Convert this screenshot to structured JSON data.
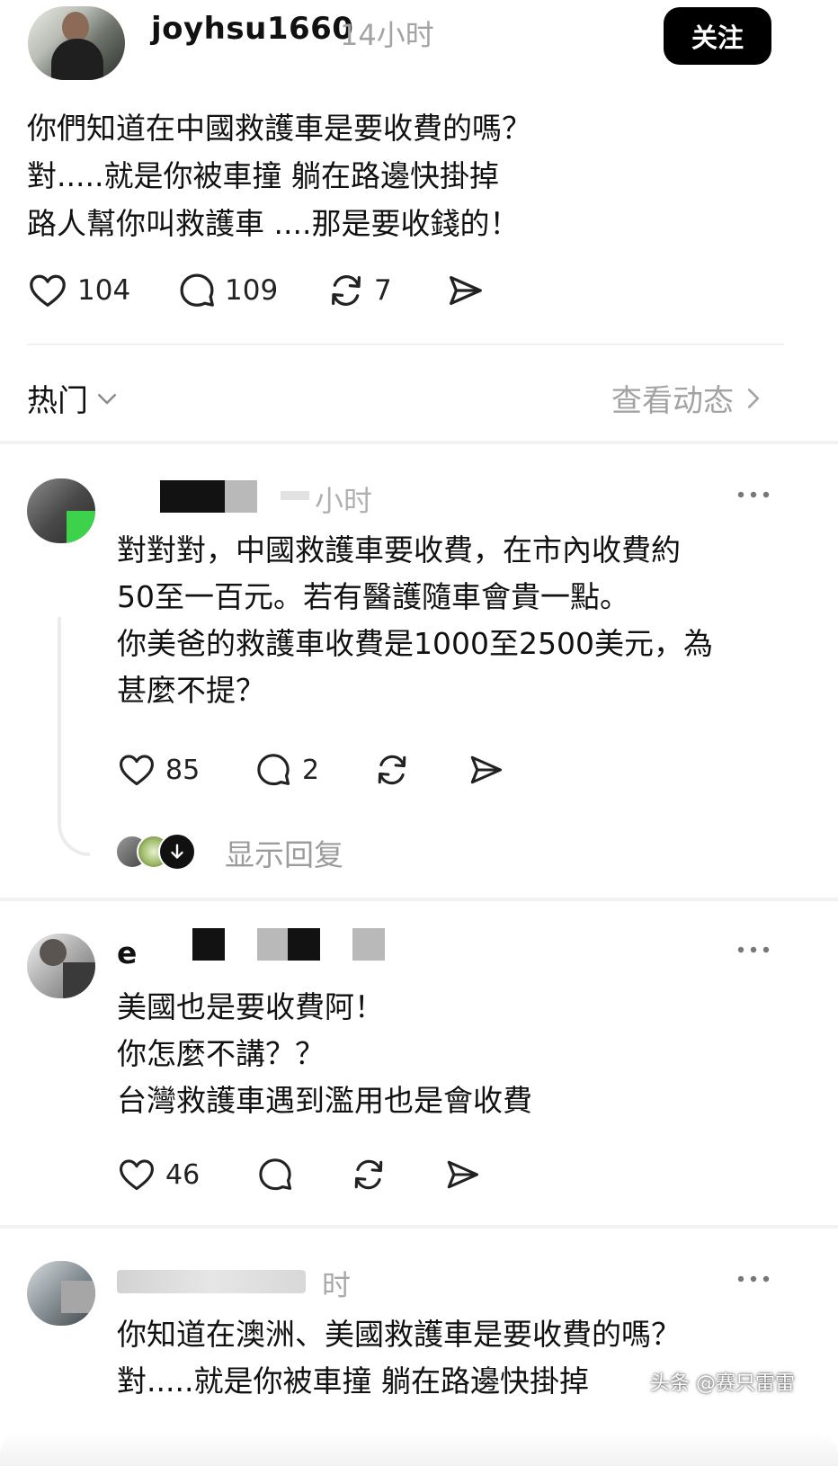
{
  "post": {
    "author": "joyhsu1660",
    "time": "14小时",
    "follow_label": "关注",
    "text": "你們知道在中國救護車是要收費的嗎？\n對.....就是你被車撞 躺在路邊快掛掉\n路人幫你叫救護車 ....那是要收錢的！",
    "likes": "104",
    "comments": "109",
    "reposts": "7"
  },
  "section": {
    "sort_label": "热门",
    "activity_label": "查看动态"
  },
  "comments": [
    {
      "time_fragment": "小时",
      "text": "對對對，中國救護車要收費，在市內收費約\n50至一百元。若有醫護隨車會貴一點。\n你美爸的救護車收費是1000至2500美元，為\n甚麼不提？",
      "likes": "85",
      "comments": "2",
      "show_replies_label": "显示回复"
    },
    {
      "name_fragment": "e",
      "text": "美國也是要收費阿！\n你怎麼不講？？\n台灣救護車遇到濫用也是會收費",
      "likes": "46"
    },
    {
      "time_fragment": "时",
      "text": "你知道在澳洲、美國救護車是要收費的嗎？\n對.....就是你被車撞 躺在路邊快掛掉"
    }
  ],
  "watermark": "头条 @赛只雷雷",
  "icons": {
    "like": "heart-icon",
    "comment": "comment-bubble-icon",
    "repost": "repost-icon",
    "share": "send-icon",
    "more": "more-dots-icon",
    "chevron_down": "chevron-down-icon",
    "chevron_right": "chevron-right-icon",
    "expand": "arrow-down-circle-icon"
  },
  "colors": {
    "text": "#111111",
    "muted": "#a3a3a3",
    "follow_bg": "#000000",
    "follow_text": "#ffffff"
  }
}
